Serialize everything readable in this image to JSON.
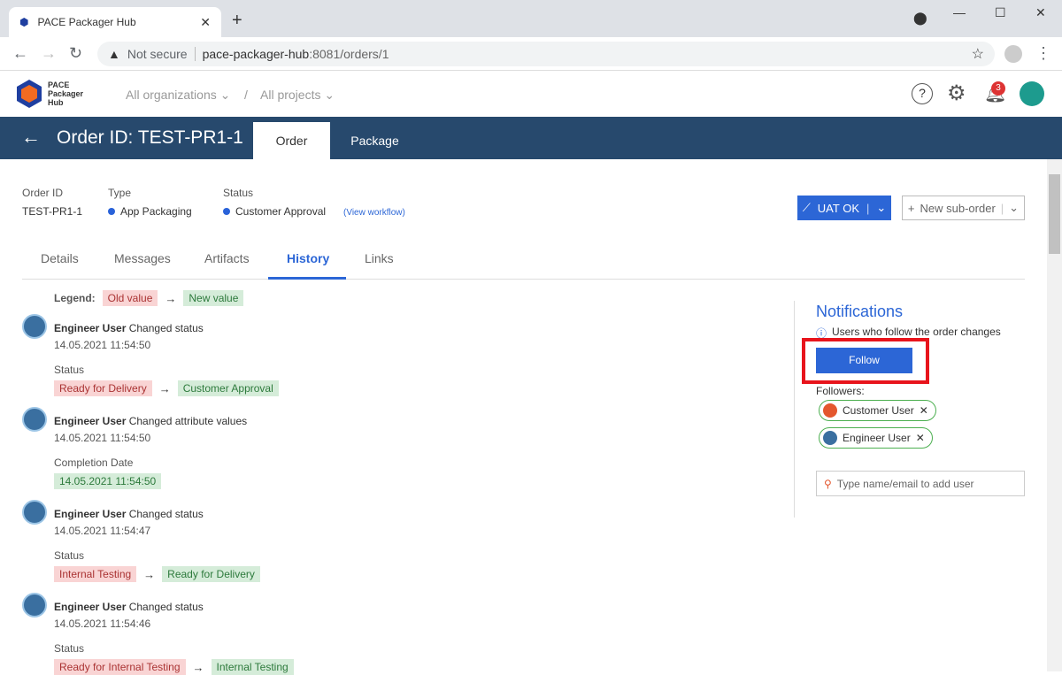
{
  "browser": {
    "tab_title": "PACE Packager Hub",
    "not_secure": "Not secure",
    "url_host": "pace-packager-hub",
    "url_rest": ":8081/orders/1"
  },
  "header": {
    "logo_text": [
      "PACE",
      "Packager",
      "Hub"
    ],
    "org": "All organizations",
    "sep": "/",
    "project": "All projects",
    "notification_count": "3"
  },
  "order": {
    "title": "Order ID: TEST-PR1-1",
    "page_tabs": [
      "Order",
      "Package"
    ],
    "meta": {
      "id_label": "Order ID",
      "id_value": "TEST-PR1-1",
      "type_label": "Type",
      "type_value": "App Packaging",
      "status_label": "Status",
      "status_value": "Customer Approval",
      "workflow_link": "(View workflow)"
    },
    "uat_button": "UAT OK",
    "suborder_button": "New sub-order",
    "tabs": [
      "Details",
      "Messages",
      "Artifacts",
      "History",
      "Links"
    ],
    "active_tab": "History"
  },
  "history": {
    "legend_label": "Legend:",
    "legend_old": "Old value",
    "legend_new": "New value",
    "entries": [
      {
        "user": "Engineer User",
        "action": "Changed status",
        "date": "14.05.2021 11:54:50",
        "field": "Status",
        "old": "Ready for Delivery",
        "new": "Customer Approval"
      },
      {
        "user": "Engineer User",
        "action": "Changed attribute values",
        "date": "14.05.2021 11:54:50",
        "field": "Completion Date",
        "old": "",
        "new": "14.05.2021 11:54:50"
      },
      {
        "user": "Engineer User",
        "action": "Changed status",
        "date": "14.05.2021 11:54:47",
        "field": "Status",
        "old": "Internal Testing",
        "new": "Ready for Delivery"
      },
      {
        "user": "Engineer User",
        "action": "Changed status",
        "date": "14.05.2021 11:54:46",
        "field": "Status",
        "old": "Ready for Internal Testing",
        "new": "Internal Testing"
      }
    ]
  },
  "notifications": {
    "title": "Notifications",
    "info": "Users who follow the order changes",
    "follow_button": "Follow",
    "followers_label": "Followers:",
    "followers": [
      "Customer User",
      "Engineer User"
    ],
    "add_placeholder": "Type name/email to add user"
  },
  "colors": {
    "brand_bar": "#27496d",
    "accent": "#2c66d6",
    "highlight": "#e8141c"
  }
}
